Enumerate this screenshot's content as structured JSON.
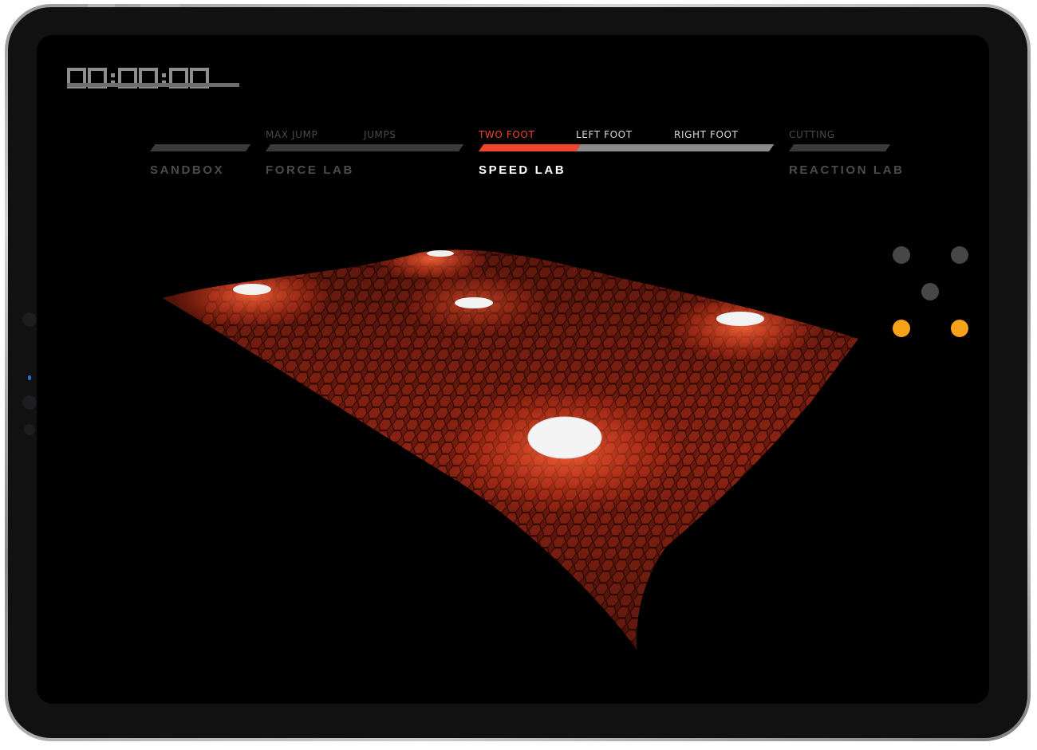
{
  "timer": {
    "text": "00:00:00"
  },
  "nav": {
    "labs": [
      {
        "title": "SANDBOX",
        "active": false,
        "subs": []
      },
      {
        "title": "FORCE LAB",
        "active": false,
        "subs": [
          "MAX JUMP",
          "JUMPS"
        ]
      },
      {
        "title": "SPEED LAB",
        "active": true,
        "subs": [
          "TWO FOOT",
          "LEFT FOOT",
          "RIGHT FOOT"
        ]
      },
      {
        "title": "REACTION LAB",
        "active": false,
        "subs": [
          "CUTTING"
        ]
      }
    ],
    "selected_sub": "TWO FOOT"
  },
  "floor": {
    "icon": "hex-floor-visualization",
    "color": "#e8452a",
    "glow_color": "#ffffff"
  },
  "pads_panel": {
    "icon": "sensor-pad-indicators",
    "pads": [
      {
        "state": "inactive"
      },
      {
        "state": "inactive"
      },
      {
        "state": "inactive"
      },
      {
        "state": "active"
      },
      {
        "state": "active"
      }
    ],
    "active_color": "#f6a21a",
    "inactive_color": "#474749"
  },
  "accent_color": "#f0442c"
}
